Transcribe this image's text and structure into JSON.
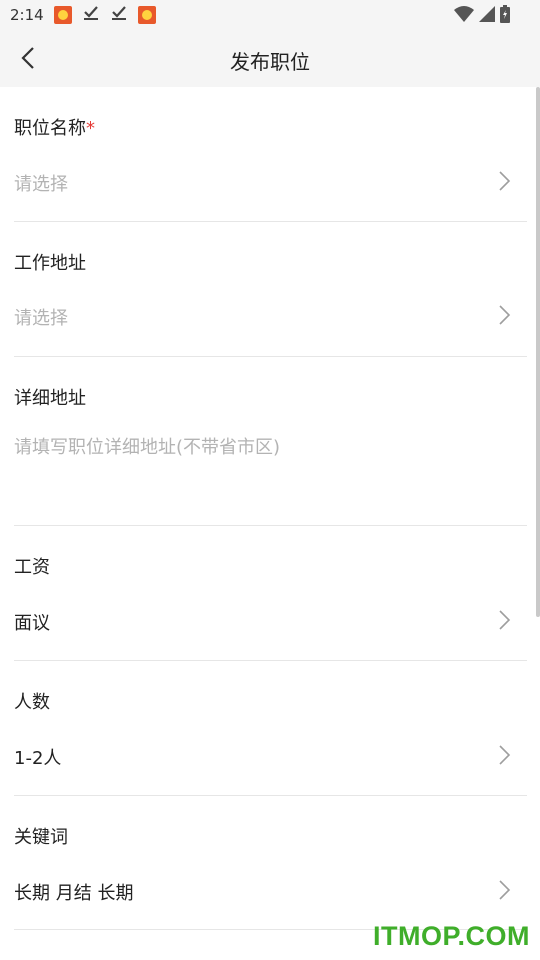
{
  "status_bar": {
    "time": "2:14",
    "notification_icons": [
      "app-icon",
      "download-done-icon",
      "download-done-icon",
      "app-icon"
    ],
    "right_icons": [
      "wifi-icon",
      "signal-icon",
      "battery-icon"
    ]
  },
  "header": {
    "title": "发布职位",
    "back_icon": "chevron-left-icon"
  },
  "form": {
    "job_title": {
      "label": "职位名称",
      "required_mark": "*",
      "placeholder": "请选择"
    },
    "work_address": {
      "label": "工作地址",
      "placeholder": "请选择"
    },
    "detail_address": {
      "label": "详细地址",
      "placeholder": "请填写职位详细地址(不带省市区)"
    },
    "salary": {
      "label": "工资",
      "value": "面议"
    },
    "headcount": {
      "label": "人数",
      "value": "1-2人"
    },
    "keywords": {
      "label": "关键词",
      "value": "长期 月结 长期"
    }
  },
  "watermark": "ITMOP.COM",
  "colors": {
    "accent_required": "#e53935",
    "placeholder": "#b3b3b3",
    "divider": "#e6e6e6",
    "watermark": "#3fae2a"
  }
}
